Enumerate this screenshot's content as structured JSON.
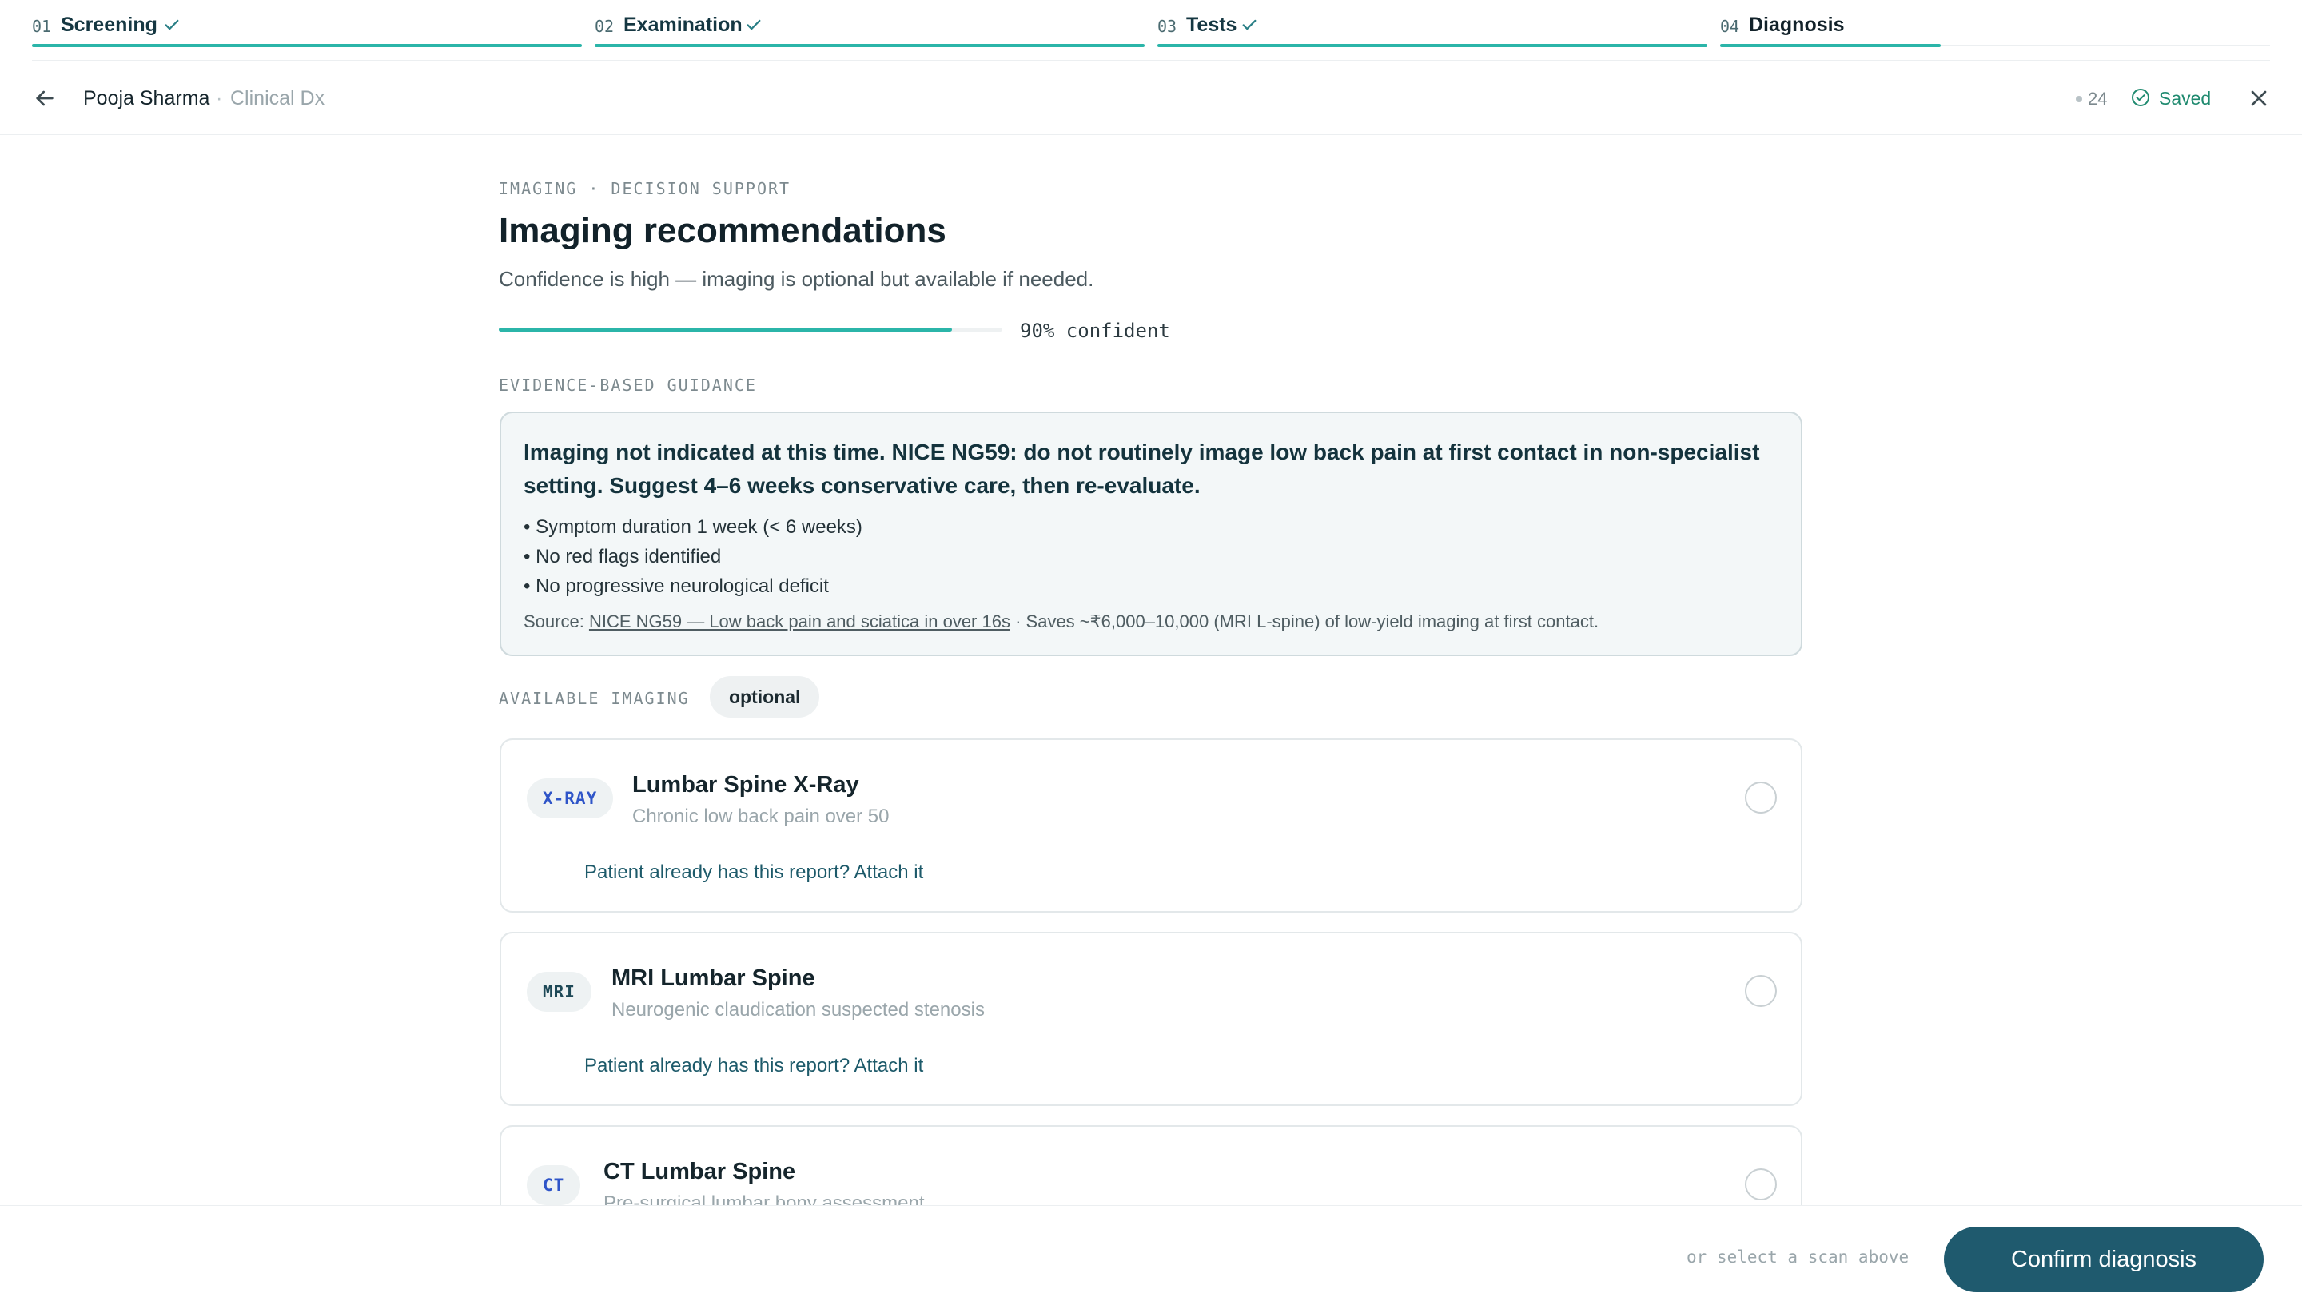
{
  "stepper": [
    {
      "num": "01",
      "label": "Screening",
      "done": true
    },
    {
      "num": "02",
      "label": "Examination",
      "done": true
    },
    {
      "num": "03",
      "label": "Tests",
      "done": true
    },
    {
      "num": "04",
      "label": "Diagnosis",
      "done": false
    }
  ],
  "header": {
    "patient_name": "Pooja Sharma",
    "separator": "·",
    "context": "Clinical Dx",
    "count": "24",
    "saved_label": "Saved"
  },
  "main": {
    "eyebrow": "IMAGING · DECISION SUPPORT",
    "title": "Imaging recommendations",
    "subtitle": "Confidence is high — imaging is optional but available if needed.",
    "confidence_percent": 90,
    "confidence_text": "90% confident",
    "guidance_label": "EVIDENCE-BASED GUIDANCE",
    "guidance": {
      "headline": "Imaging not indicated at this time. NICE NG59: do not routinely image low back pain at first contact in non-specialist setting. Suggest 4–6 weeks conservative care, then re-evaluate.",
      "bullets": [
        "Symptom duration 1 week (< 6 weeks)",
        "No red flags identified",
        "No progressive neurological deficit"
      ],
      "source_prefix": "Source: ",
      "source_link": "NICE NG59 — Low back pain and sciatica in over 16s",
      "source_suffix": " · Saves ~₹6,000–10,000 (MRI L-spine) of low-yield imaging at first contact."
    },
    "available_label": "AVAILABLE IMAGING",
    "optional_pill": "optional",
    "imaging": [
      {
        "badge": "X-RAY",
        "title": "Lumbar Spine X-Ray",
        "subtitle": "Chronic low back pain over 50",
        "attach": "Patient already has this report? Attach it"
      },
      {
        "badge": "MRI",
        "title": "MRI Lumbar Spine",
        "subtitle": "Neurogenic claudication suspected stenosis",
        "attach": "Patient already has this report? Attach it"
      },
      {
        "badge": "CT",
        "title": "CT Lumbar Spine",
        "subtitle": "Pre-surgical lumbar bony assessment",
        "attach": ""
      }
    ]
  },
  "footer": {
    "hint": "or select a scan above",
    "confirm_label": "Confirm diagnosis"
  },
  "colors": {
    "accent": "#2bb5a9",
    "primary": "#1f5a6e",
    "saved_green": "#1f8a6f"
  }
}
